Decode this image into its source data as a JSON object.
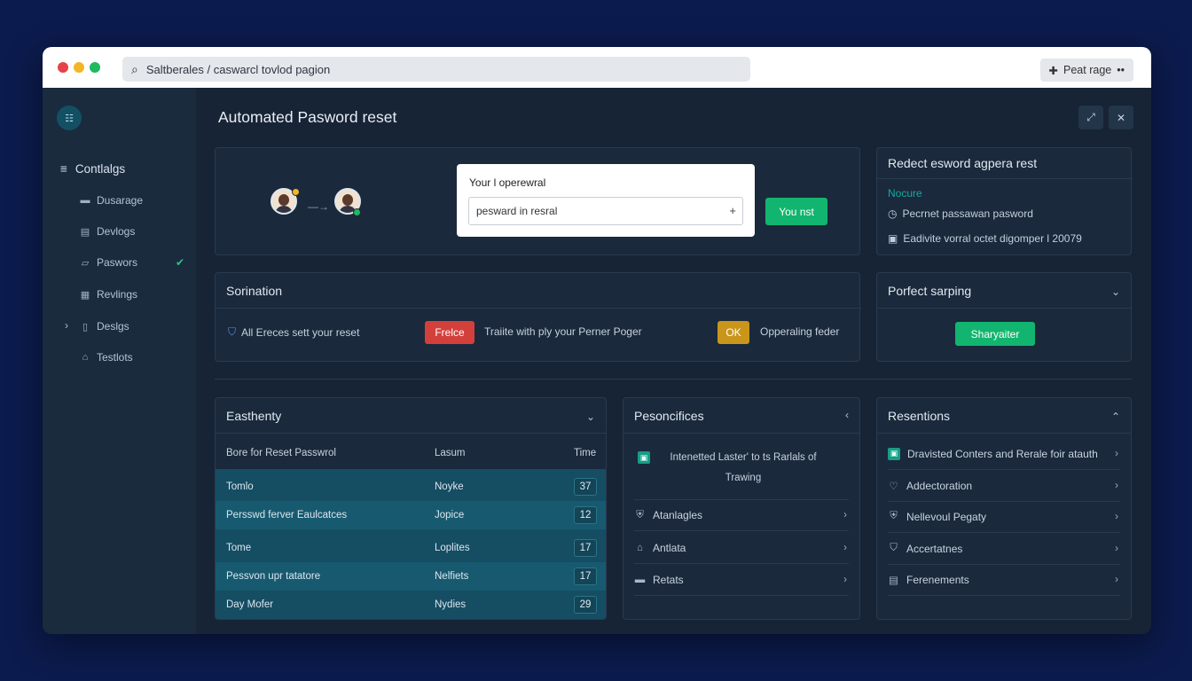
{
  "browser": {
    "url": "Saltberales / caswarcl tovlod pagion",
    "action_label": "Peat rage",
    "dots": [
      "#e8404a",
      "#f3b528",
      "#1fb95f"
    ]
  },
  "sidebar": {
    "header": "Contlalgs",
    "items": [
      {
        "label": "Dusarage",
        "icon": "folder-icon"
      },
      {
        "label": "Devlogs",
        "icon": "window-icon"
      },
      {
        "label": "Paswors",
        "icon": "folder-icon",
        "checked": true
      },
      {
        "label": "Revlings",
        "icon": "grid-icon"
      },
      {
        "label": "Deslgs",
        "icon": "document-icon",
        "expandable": true
      },
      {
        "label": "Testlots",
        "icon": "lock-icon"
      }
    ]
  },
  "main": {
    "title": "Automated Pasword reset"
  },
  "hero": {
    "card_label": "Your l operewral",
    "input_value": "pesward in resral",
    "button_label": "You nst"
  },
  "info_panel": {
    "title": "Redect esword agpera rest",
    "subtitle": "Nocure",
    "rows": [
      {
        "icon": "clock-icon",
        "text": "Pecrnet passawan pasword"
      },
      {
        "icon": "calendar-icon",
        "text": "Eadivite vorral octet digomper l 20079"
      }
    ]
  },
  "sorination": {
    "title": "Sorination",
    "item1": "All Ereces sett your reset",
    "badge_red": "Frelce",
    "item2": "Traiite with ply your Perner Poger",
    "badge_yellow": "OK",
    "item3": "Opperaling feder",
    "colors": {
      "red": "#d3403b",
      "yellow": "#c9961b"
    }
  },
  "perfect": {
    "title": "Porfect sarping",
    "button_label": "Sharyaiter"
  },
  "table": {
    "title": "Easthenty",
    "headers": [
      "Bore for Reset Passwrol",
      "Lasum",
      "Time"
    ],
    "rows": [
      {
        "name": "Tomlo",
        "type": "Noyke",
        "time": "37"
      },
      {
        "name": "Persswd ferver Eaulcatces",
        "type": "Jopice",
        "time": "12"
      },
      {
        "name": "Tome",
        "type": "Loplites",
        "time": "17"
      },
      {
        "name": "Pessvon upr tatatore",
        "type": "Nelfiets",
        "time": "17"
      },
      {
        "name": "Day Mofer",
        "type": "Nydies",
        "time": "29"
      }
    ]
  },
  "personal": {
    "title": "Pesoncifices",
    "intro": "Intenetted Laster' to ts Rarlals of Trawing",
    "items": [
      {
        "icon": "tag-icon",
        "label": "Atanlagles"
      },
      {
        "icon": "bell-icon",
        "label": "Antlata"
      },
      {
        "icon": "card-icon",
        "label": "Retats"
      }
    ]
  },
  "resentions": {
    "title": "Resentions",
    "items": [
      {
        "icon": "teal-box-icon",
        "label": "Dravisted Conters and Rerale foir atauth"
      },
      {
        "icon": "heart-icon",
        "label": "Addectoration"
      },
      {
        "icon": "tag-icon",
        "label": "Nellevoul Pegaty"
      },
      {
        "icon": "shield-icon",
        "label": "Accertatnes"
      },
      {
        "icon": "document-icon",
        "label": "Ferenements"
      }
    ]
  }
}
